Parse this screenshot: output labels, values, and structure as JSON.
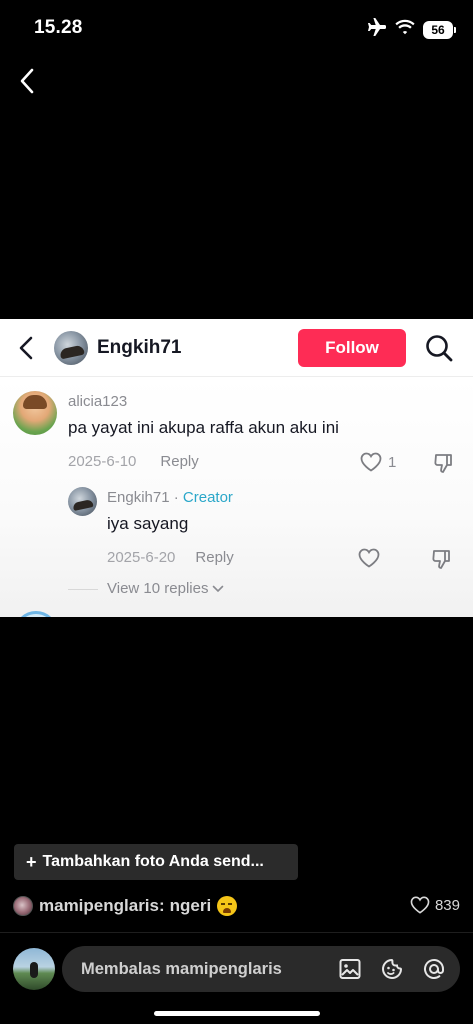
{
  "status_bar": {
    "time": "15.28",
    "battery": "56"
  },
  "screenshot": {
    "header": {
      "username": "Engkih71",
      "follow_label": "Follow"
    },
    "comment": {
      "author": "alicia123",
      "text": "pa yayat ini akupa raffa akun aku ini",
      "date": "2025-6-10",
      "reply_label": "Reply",
      "likes": "1"
    },
    "reply": {
      "author": "Engkih71",
      "separator": " · ",
      "badge": "Creator",
      "text": "iya sayang",
      "date": "2025-6-20",
      "reply_label": "Reply"
    },
    "view_replies": "View 10 replies"
  },
  "overlay": {
    "add_photo": "Tambahkan foto Anda send...",
    "comment": {
      "username": "mamipenglaris:",
      "text": "ngeri",
      "emoji": "crying-face-emoji"
    },
    "likes": "839"
  },
  "reply_bar": {
    "placeholder": "Membalas mamipenglaris"
  },
  "colors": {
    "follow": "#fe2c55",
    "creator": "#2aa7c9",
    "background": "#000000"
  }
}
